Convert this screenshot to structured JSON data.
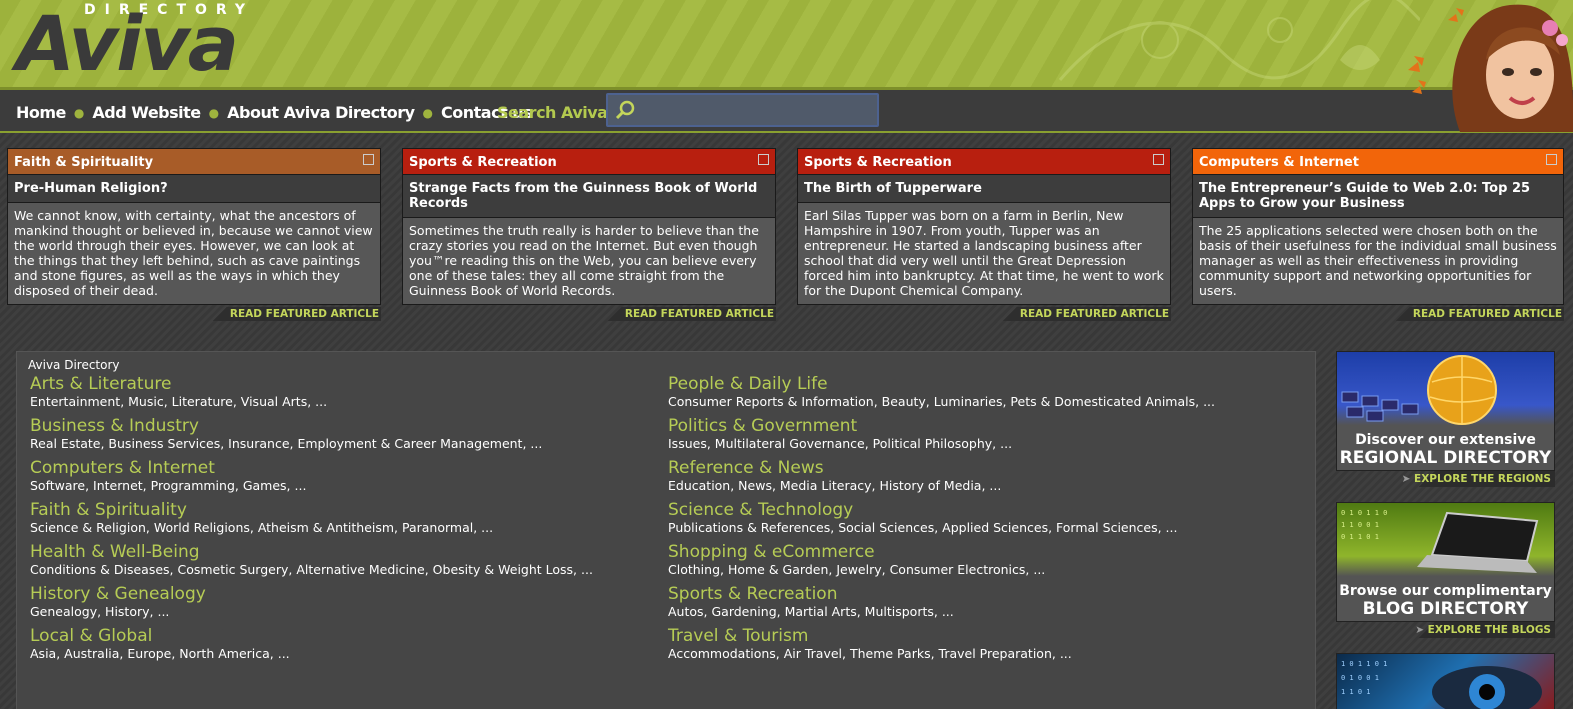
{
  "header": {
    "logo_sub": "DIRECTORY",
    "logo_main": "Aviva"
  },
  "nav": {
    "items": [
      {
        "label": "Home"
      },
      {
        "label": "Add Website"
      },
      {
        "label": "About Aviva Directory"
      },
      {
        "label": "Contact us"
      }
    ],
    "search_label": "Search Aviva:",
    "search_value": "",
    "search_placeholder": ""
  },
  "featured": [
    {
      "category": "Faith & Spirituality",
      "color": "#a85c28",
      "title": "Pre-Human Religion?",
      "body": "We cannot know, with certainty, what the ancestors of mankind thought or believed in, because we cannot view the world through their eyes. However, we can look at the things that they left behind, such as cave paintings and stone figures, as well as the ways in which they disposed of their dead.",
      "link": "READ FEATURED ARTICLE"
    },
    {
      "category": "Sports & Recreation",
      "color": "#b81f0f",
      "title": "Strange Facts from the Guinness Book of World Records",
      "body": "Sometimes the truth really is harder to believe than the crazy stories you read on the Internet. But even though you™re reading this on the Web, you can believe every one of these tales: they all come straight from the Guinness Book of World Records.",
      "link": "READ FEATURED ARTICLE"
    },
    {
      "category": "Sports & Recreation",
      "color": "#b81f0f",
      "title": "The Birth of Tupperware",
      "body": "Earl Silas Tupper was born on a farm in Berlin, New Hampshire in 1907. From youth, Tupper was an entrepreneur. He started a landscaping business after school that did very well until the Great Depression forced him into bankruptcy. At that time, he went to work for the Dupont Chemical Company.",
      "link": "READ FEATURED ARTICLE"
    },
    {
      "category": "Computers & Internet",
      "color": "#f2650a",
      "title": "The Entrepreneur’s Guide to Web 2.0: Top 25 Apps to Grow your Business",
      "body": "The 25 applications selected were chosen both on the basis of their usefulness for the individual small business manager as well as their effectiveness in providing community support and networking opportunities for users.",
      "link": "READ FEATURED ARTICLE"
    }
  ],
  "directory": {
    "label": "Aviva Directory",
    "left": [
      {
        "name": "Arts & Literature",
        "subs": "Entertainment, Music, Literature, Visual Arts, ..."
      },
      {
        "name": "Business & Industry",
        "subs": "Real Estate, Business Services, Insurance, Employment & Career Management, ..."
      },
      {
        "name": "Computers & Internet",
        "subs": "Software, Internet, Programming, Games, ..."
      },
      {
        "name": "Faith & Spirituality",
        "subs": "Science & Religion, World Religions, Atheism & Antitheism, Paranormal, ..."
      },
      {
        "name": "Health & Well-Being",
        "subs": "Conditions & Diseases, Cosmetic Surgery, Alternative Medicine, Obesity & Weight Loss, ..."
      },
      {
        "name": "History & Genealogy",
        "subs": "Genealogy, History, ..."
      },
      {
        "name": "Local & Global",
        "subs": "Asia, Australia, Europe, North America, ..."
      }
    ],
    "right": [
      {
        "name": "People & Daily Life",
        "subs": "Consumer Reports & Information, Beauty, Luminaries, Pets & Domesticated Animals, ..."
      },
      {
        "name": "Politics & Government",
        "subs": "Issues, Multilateral Governance, Political Philosophy, ..."
      },
      {
        "name": "Reference & News",
        "subs": "Education, News, Media Literacy, History of Media, ..."
      },
      {
        "name": "Science & Technology",
        "subs": "Publications & References, Social Sciences, Applied Sciences, Formal Sciences, ..."
      },
      {
        "name": "Shopping & eCommerce",
        "subs": "Clothing, Home & Garden, Jewelry, Consumer Electronics, ..."
      },
      {
        "name": "Sports & Recreation",
        "subs": "Autos, Gardening, Martial Arts, Multisports, ..."
      },
      {
        "name": "Travel & Tourism",
        "subs": "Accommodations, Air Travel, Theme Parks, Travel Preparation, ..."
      }
    ]
  },
  "ads": [
    {
      "line1": "Discover our extensive",
      "line2": "REGIONAL DIRECTORY",
      "link": "EXPLORE THE REGIONS"
    },
    {
      "line1": "Browse our complimentary",
      "line2": "BLOG DIRECTORY",
      "link": "EXPLORE THE BLOGS"
    }
  ]
}
